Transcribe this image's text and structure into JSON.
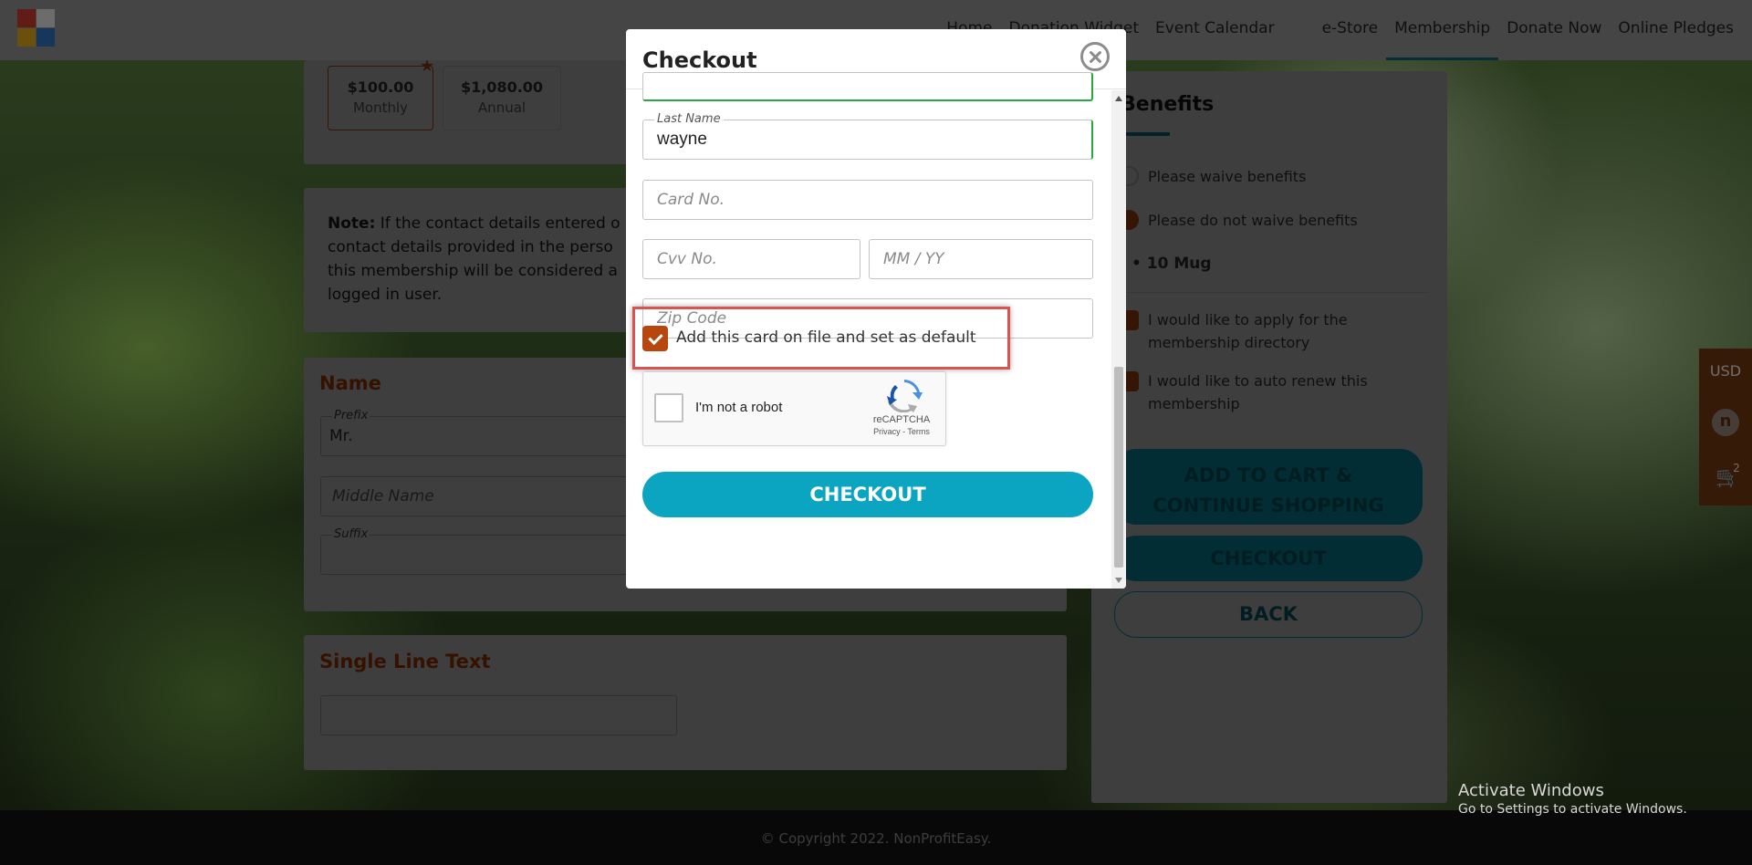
{
  "nav": {
    "items": [
      "Home",
      "Donation Widget",
      "Event Calendar",
      "e-Store",
      "Membership",
      "Donate Now",
      "Online Pledges"
    ],
    "active": "Membership"
  },
  "pricing": {
    "options": [
      {
        "amount": "$100.00",
        "period": "Monthly",
        "selected": true
      },
      {
        "amount": "$1,080.00",
        "period": "Annual",
        "selected": false
      }
    ]
  },
  "note": {
    "label": "Note:",
    "text": " If the contact details entered o contact details provided in the perso this membership will be considered a logged in user."
  },
  "name_section": {
    "title": "Name",
    "prefix_label": "Prefix",
    "prefix_value": "Mr.",
    "middle_name_placeholder": "Middle Name",
    "suffix_label": "Suffix"
  },
  "single_line_section": {
    "title": "Single Line Text"
  },
  "benefits": {
    "title": "Benefits",
    "options": [
      "Please waive benefits",
      "Please do not waive benefits"
    ],
    "items": [
      "10 Mug"
    ],
    "checkboxes": [
      "I would like to apply for the membership directory",
      "I would like to auto renew this membership"
    ],
    "buttons": {
      "add_to_cart": "ADD TO CART & CONTINUE SHOPPING",
      "checkout": "CHECKOUT",
      "back": "BACK"
    }
  },
  "side": {
    "currency": "USD",
    "avatar": "n",
    "cart_count": "2"
  },
  "footer": {
    "copyright": "© Copyright 2022. NonProfitEasy."
  },
  "windows": {
    "line1": "Activate Windows",
    "line2": "Go to Settings to activate Windows."
  },
  "modal": {
    "title": "Checkout",
    "last_name_label": "Last Name",
    "last_name_value": "wayne",
    "card_placeholder": "Card No.",
    "cvv_placeholder": "Cvv No.",
    "expiry_placeholder": "MM / YY",
    "zip_placeholder": "Zip Code",
    "save_card_label": "Add this card on file and set as default",
    "save_card_checked": true,
    "recaptcha": {
      "text": "I'm not a robot",
      "brand": "reCAPTCHA",
      "links": "Privacy - Terms"
    },
    "checkout_label": "CHECKOUT"
  },
  "colors": {
    "accent": "#0ba5c1",
    "checkbox": "#b8460f",
    "highlight": "#d9534f"
  }
}
